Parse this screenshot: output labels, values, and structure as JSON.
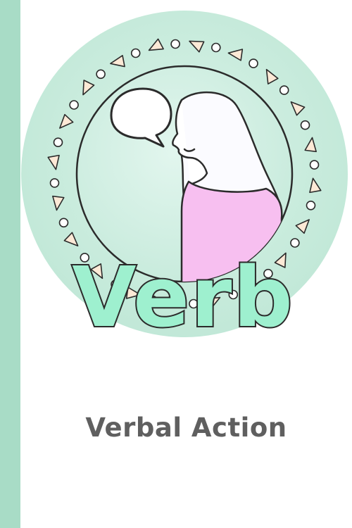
{
  "cover": {
    "word": "Verb",
    "subtitle": "Verbal Action"
  },
  "colors": {
    "spine": "#a8dcc6",
    "badge_background": "#cfeee0",
    "badge_inner": "#d8f1e7",
    "word_fill": "#9ef0cf",
    "outline": "#2b2b2b",
    "shirt": "#f7bff0",
    "hair": "#fbfbff",
    "triangle": "#fde9d6",
    "subtitle": "#5f5f5f"
  },
  "icons": {
    "speech": "speech-bubble-icon",
    "person": "person-silhouette-icon"
  }
}
